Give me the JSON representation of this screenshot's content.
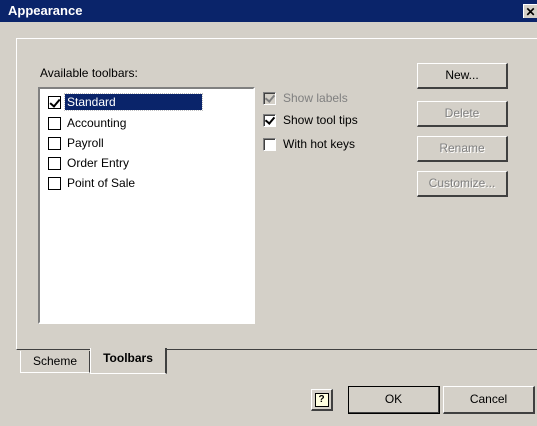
{
  "window": {
    "title": "Appearance",
    "close_glyph": "✕"
  },
  "toolbars_tab": {
    "list_label": "Available toolbars:",
    "items": [
      {
        "label": "Standard",
        "checked": true,
        "selected": true
      },
      {
        "label": "Accounting",
        "checked": false,
        "selected": false
      },
      {
        "label": "Payroll",
        "checked": false,
        "selected": false
      },
      {
        "label": "Order Entry",
        "checked": false,
        "selected": false
      },
      {
        "label": "Point of Sale",
        "checked": false,
        "selected": false
      }
    ],
    "options": [
      {
        "label": "Show labels",
        "checked": true,
        "enabled": false
      },
      {
        "label": "Show tool tips",
        "checked": true,
        "enabled": true
      },
      {
        "label": "With hot keys",
        "checked": false,
        "enabled": true
      }
    ],
    "buttons": {
      "new": "New...",
      "delete": "Delete",
      "rename": "Rename",
      "customize": "Customize..."
    }
  },
  "tabs": [
    {
      "label": "Scheme",
      "active": false
    },
    {
      "label": "Toolbars",
      "active": true
    }
  ],
  "footer": {
    "help_icon": "help-icon",
    "help_glyph": "?",
    "ok": "OK",
    "cancel": "Cancel"
  }
}
